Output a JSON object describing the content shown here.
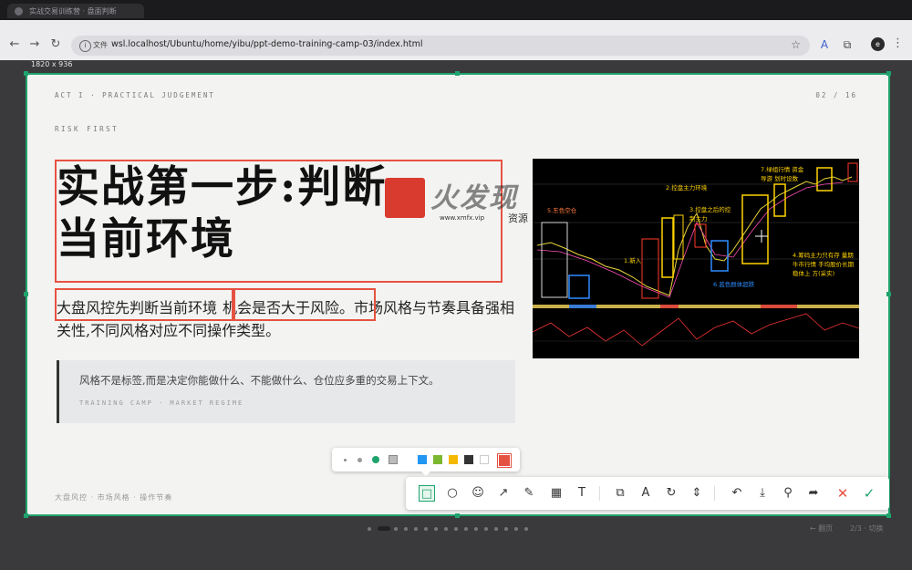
{
  "browser": {
    "tab_title": "实战交易训练营 · 盘面判断",
    "address_label": "文件",
    "url": "wsl.localhost/Ubuntu/home/yibu/ppt-demo-training-camp-03/index.html",
    "avatar_letter": "e",
    "dimensions_label": "1820 x 936"
  },
  "slide": {
    "kicker_left": "ACT I · PRACTICAL JUDGEMENT",
    "page_counter": "02 / 16",
    "section_label": "RISK FIRST",
    "title_line1": "实战第一步:判断",
    "title_line2": "当前环境",
    "lead_part1": "大盘风控先判断当前环境",
    "lead_part2": "机会是否大于风险。",
    "lead_part3": "市场风格与节奏具备强相关性,不同风格对应不同操作类型。",
    "quote_text": "风格不是标签,而是决定你能做什么、不能做什么、仓位应多重的交易上下文。",
    "quote_meta": "TRAINING CAMP · MARKET REGIME",
    "footer_tags": "大盘风控 · 市场风格 · 操作节奏"
  },
  "chart_image": {
    "labels": {
      "a1": "5.东色空仓",
      "a2": "2.控盘主力环境",
      "a3": "3.控盘之后的控制主力",
      "a4": "7.绿组行情 资金导游 划时设数",
      "a5": "1.新入",
      "a6": "6.蓝色群体超跌",
      "a7": "4.筹码主力只有存 量期牛市行情 手均股价长期稳体上 方(采实)"
    }
  },
  "watermark": {
    "text": "火发现",
    "url": "www.xmfx.vip",
    "res": "资源"
  },
  "palette": {
    "colors": [
      "#2196f3",
      "#7cb82f",
      "#f5b800",
      "#333333",
      "#ffffff",
      "#e65242"
    ],
    "sizes": [
      "small",
      "medium",
      "large"
    ]
  },
  "toolbar": {
    "tools": [
      "rectangle-tool",
      "ellipse-tool",
      "emoji-tool",
      "arrow-tool",
      "pen-tool",
      "mosaic-tool",
      "text-tool",
      "pin-tool",
      "ocr-tool",
      "scroll-capture-tool",
      "long-capture-tool",
      "undo-tool",
      "save-tool",
      "pin-screen-tool",
      "share-tool",
      "cancel-tool",
      "confirm-tool"
    ]
  },
  "pager": {
    "total": 16,
    "current": 2
  },
  "bottom_hints": {
    "left": "← 翻页",
    "right": "2/3 · 切换"
  }
}
